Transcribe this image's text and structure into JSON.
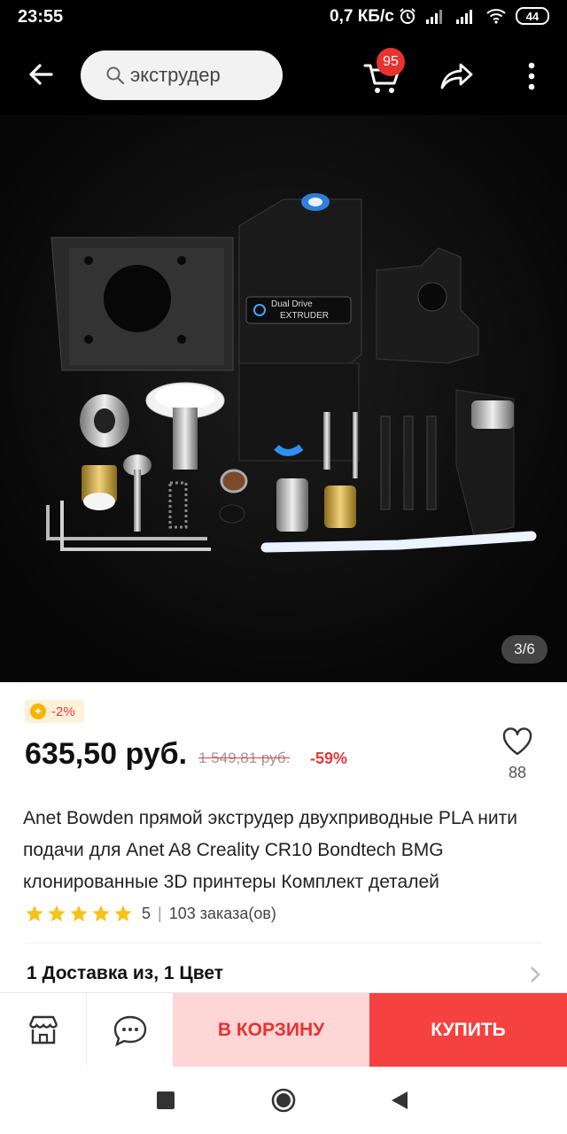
{
  "status_bar": {
    "time": "23:55",
    "speed": "0,7 КБ/с",
    "battery": "44"
  },
  "app_bar": {
    "search_text": "экструдер",
    "cart_count": "95"
  },
  "gallery": {
    "counter": "3/6",
    "label_line1": "Dual Drive",
    "label_line2": "EXTRUDER"
  },
  "product": {
    "coupon": "-2%",
    "price": "635,50 руб.",
    "old_price": "1 549,81 руб.",
    "discount": "-59%",
    "wishlist_count": "88",
    "title": "Anet Bowden прямой экструдер двухприводные PLA нити подачи для Anet A8 Creality CR10 Bondtech BMG клонированные 3D принтеры Комплект деталей",
    "rating": "5",
    "orders": "103 заказа(ов)",
    "shipping": "1 Доставка из, 1 Цвет"
  },
  "actions": {
    "add_to_cart": "В КОРЗИНУ",
    "buy": "КУПИТЬ"
  },
  "colors": {
    "accent_red": "#f5413f",
    "light_red": "#ffd6d6",
    "star_yellow": "#f7c21b"
  }
}
